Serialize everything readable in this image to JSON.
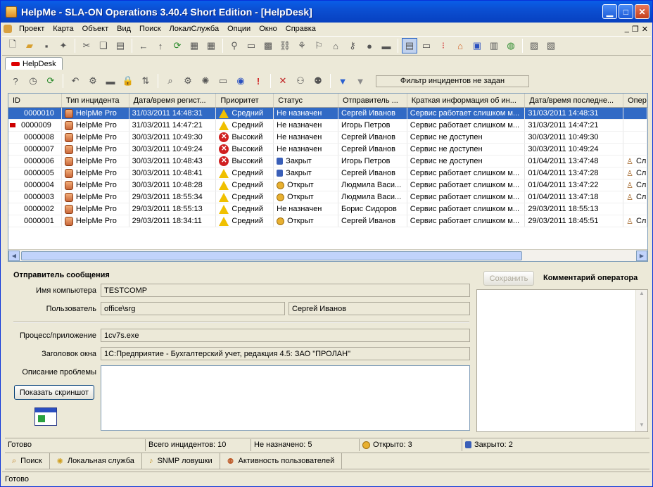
{
  "window": {
    "title": "HelpMe - SLA-ON Operations 3.40.4 Short Edition - [HelpDesk]"
  },
  "menu": [
    "Проект",
    "Карта",
    "Объект",
    "Вид",
    "Поиск",
    "ЛокалСлужба",
    "Опции",
    "Окно",
    "Справка"
  ],
  "tab": {
    "label": "HelpDesk"
  },
  "filter": {
    "label": "Фильтр инцидентов не задан"
  },
  "grid": {
    "headers": [
      "ID",
      "Тип инцидента",
      "Дата/время регист...",
      "Приоритет",
      "Статус",
      "Отправитель ...",
      "Краткая информация об ин...",
      "Дата/время последне...",
      "Опера"
    ],
    "rows": [
      {
        "id": "0000010",
        "type": "HelpMe Pro",
        "reg": "31/03/2011 14:48:31",
        "prio": "Средний",
        "prio_level": "medium",
        "status": "Не назначен",
        "status_icon": "none",
        "sender": "Сергей Иванов",
        "info": "Сервис работает слишком м...",
        "last": "31/03/2011 14:48:31",
        "op": "",
        "selected": true,
        "flag": false
      },
      {
        "id": "0000009",
        "type": "HelpMe Pro",
        "reg": "31/03/2011 14:47:21",
        "prio": "Средний",
        "prio_level": "medium",
        "status": "Не назначен",
        "status_icon": "none",
        "sender": "Игорь Петров",
        "info": "Сервис работает слишком м...",
        "last": "31/03/2011 14:47:21",
        "op": "",
        "selected": false,
        "flag": true
      },
      {
        "id": "0000008",
        "type": "HelpMe Pro",
        "reg": "30/03/2011 10:49:30",
        "prio": "Высокий",
        "prio_level": "high",
        "status": "Не назначен",
        "status_icon": "none",
        "sender": "Сергей Иванов",
        "info": "Сервис не доступен",
        "last": "30/03/2011 10:49:30",
        "op": "",
        "selected": false,
        "flag": false
      },
      {
        "id": "0000007",
        "type": "HelpMe Pro",
        "reg": "30/03/2011 10:49:24",
        "prio": "Высокий",
        "prio_level": "high",
        "status": "Не назначен",
        "status_icon": "none",
        "sender": "Сергей Иванов",
        "info": "Сервис не доступен",
        "last": "30/03/2011 10:49:24",
        "op": "",
        "selected": false,
        "flag": false
      },
      {
        "id": "0000006",
        "type": "HelpMe Pro",
        "reg": "30/03/2011 10:48:43",
        "prio": "Высокий",
        "prio_level": "high",
        "status": "Закрыт",
        "status_icon": "lock",
        "sender": "Игорь Петров",
        "info": "Сервис не доступен",
        "last": "01/04/2011 13:47:48",
        "op": "Сл",
        "selected": false,
        "flag": false
      },
      {
        "id": "0000005",
        "type": "HelpMe Pro",
        "reg": "30/03/2011 10:48:41",
        "prio": "Средний",
        "prio_level": "medium",
        "status": "Закрыт",
        "status_icon": "lock",
        "sender": "Сергей Иванов",
        "info": "Сервис работает слишком м...",
        "last": "01/04/2011 13:47:28",
        "op": "Сл",
        "selected": false,
        "flag": false
      },
      {
        "id": "0000004",
        "type": "HelpMe Pro",
        "reg": "30/03/2011 10:48:28",
        "prio": "Средний",
        "prio_level": "medium",
        "status": "Открыт",
        "status_icon": "open",
        "sender": "Людмила Васи...",
        "info": "Сервис работает слишком м...",
        "last": "01/04/2011 13:47:22",
        "op": "Сл",
        "selected": false,
        "flag": false
      },
      {
        "id": "0000003",
        "type": "HelpMe Pro",
        "reg": "29/03/2011 18:55:34",
        "prio": "Средний",
        "prio_level": "medium",
        "status": "Открыт",
        "status_icon": "open",
        "sender": "Людмила Васи...",
        "info": "Сервис работает слишком м...",
        "last": "01/04/2011 13:47:18",
        "op": "Сл",
        "selected": false,
        "flag": false
      },
      {
        "id": "0000002",
        "type": "HelpMe Pro",
        "reg": "29/03/2011 18:55:13",
        "prio": "Средний",
        "prio_level": "medium",
        "status": "Не назначен",
        "status_icon": "none",
        "sender": "Борис Сидоров",
        "info": "Сервис работает слишком м...",
        "last": "29/03/2011 18:55:13",
        "op": "",
        "selected": false,
        "flag": false
      },
      {
        "id": "0000001",
        "type": "HelpMe Pro",
        "reg": "29/03/2011 18:34:11",
        "prio": "Средний",
        "prio_level": "medium",
        "status": "Открыт",
        "status_icon": "open",
        "sender": "Сергей Иванов",
        "info": "Сервис работает слишком м...",
        "last": "29/03/2011 18:45:51",
        "op": "Сл",
        "selected": false,
        "flag": false
      }
    ]
  },
  "detail": {
    "title": "Отправитель сообщения",
    "computer_label": "Имя компьютера",
    "computer": "TESTCOMP",
    "user_label": "Пользователь",
    "user_login": "office\\srg",
    "user_name": "Сергей Иванов",
    "process_label": "Процесс/приложение",
    "process": "1cv7s.exe",
    "window_label": "Заголовок окна",
    "window_title": "1С:Предприятие - Бухгалтерский учет, редакция 4.5: ЗАО \"ПРОЛАН\"",
    "desc_label": "Описание проблемы",
    "screenshot_button": "Показать скриншот"
  },
  "comment": {
    "save_button": "Сохранить",
    "title": "Комментарий оператора"
  },
  "status": {
    "ready": "Готово",
    "total": "Всего инцидентов: 10",
    "unassigned": "Не назначено: 5",
    "open": "Открыто: 3",
    "closed": "Закрыто: 2"
  },
  "nav": [
    "Поиск",
    "Локальная служба",
    "SNMP ловушки",
    "Активность пользователей"
  ],
  "bottom_status": "Готово"
}
